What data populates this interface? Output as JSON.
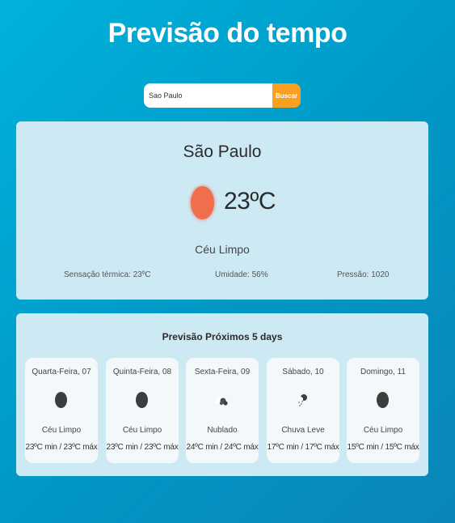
{
  "header": {
    "title": "Previsão do tempo"
  },
  "search": {
    "value": "Sao Paulo",
    "placeholder": "",
    "button_label": "Buscar"
  },
  "current": {
    "city": "São Paulo",
    "temperature": "23ºC",
    "icon": "sun-icon",
    "condition": "Céu Limpo",
    "feels_like": "Sensação térmica: 23ºC",
    "humidity": "Umidade: 56%",
    "pressure": "Pressão: 1020"
  },
  "forecast": {
    "title": "Previsão Próximos 5 days",
    "days": [
      {
        "name": "Quarta-Feira, 07",
        "icon": "clear-icon",
        "condition": "Céu Limpo",
        "temps": "23ºC min / 23ºC máx"
      },
      {
        "name": "Quinta-Feira, 08",
        "icon": "clear-icon",
        "condition": "Céu Limpo",
        "temps": "23ºC min / 23ºC máx"
      },
      {
        "name": "Sexta-Feira, 09",
        "icon": "cloud-icon",
        "condition": "Nublado",
        "temps": "24ºC min / 24ºC máx"
      },
      {
        "name": "Sábado, 10",
        "icon": "rain-icon",
        "condition": "Chuva Leve",
        "temps": "17ºC min / 17ºC máx"
      },
      {
        "name": "Domingo, 11",
        "icon": "clear-icon",
        "condition": "Céu Limpo",
        "temps": "15ºC min / 15ºC máx"
      }
    ]
  }
}
